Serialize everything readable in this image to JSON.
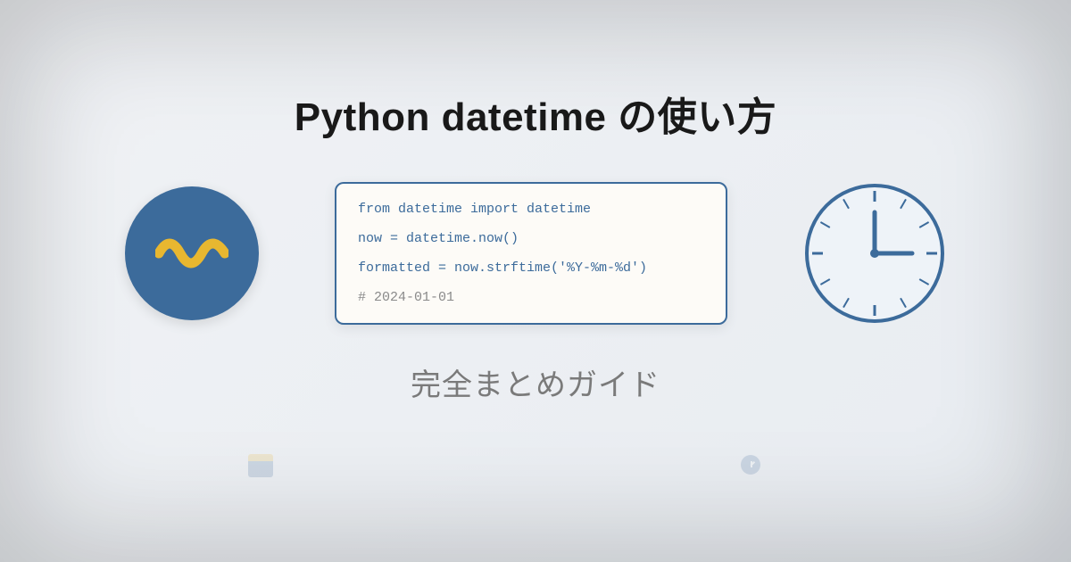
{
  "title": "Python datetime の使い方",
  "subtitle": "完全まとめガイド",
  "code": {
    "line1": "from datetime import datetime",
    "line2": "now = datetime.now()",
    "line3": "formatted = now.strftime('%Y-%m-%d')",
    "line4": "# 2024-01-01"
  },
  "colors": {
    "primary": "#3c6b9b",
    "accent": "#e8b730"
  }
}
